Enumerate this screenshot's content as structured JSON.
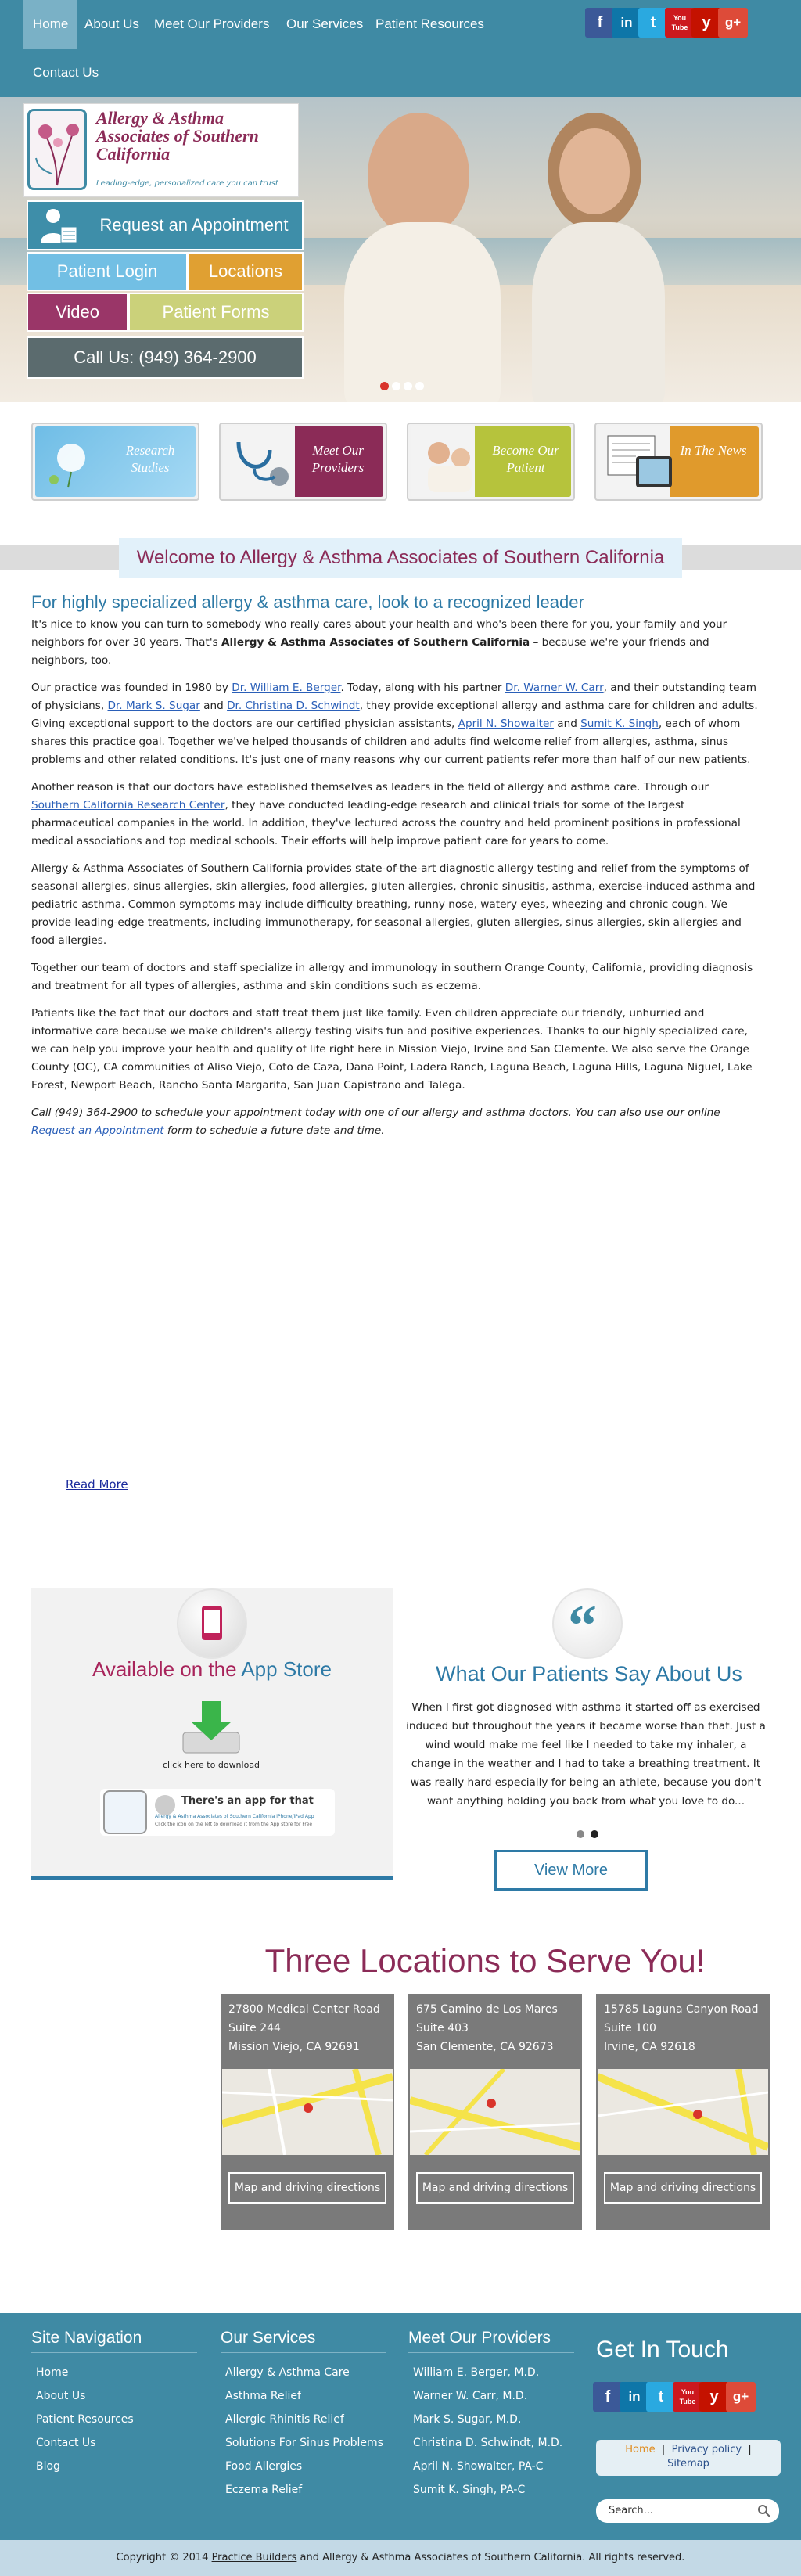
{
  "nav": {
    "items": [
      {
        "label": "Home"
      },
      {
        "label": "About Us"
      },
      {
        "label": "Meet Our Providers"
      },
      {
        "label": "Our Services"
      },
      {
        "label": "Patient Resources"
      },
      {
        "label": "Contact Us"
      }
    ],
    "social": [
      "f",
      "in",
      "t",
      "You Tube",
      "y",
      "g+"
    ]
  },
  "hero": {
    "logo_name": "Allergy & Asthma Associates of Southern California",
    "logo_tag": "Leading-edge, personalized care you can trust",
    "request": "Request an Appointment",
    "patient_login": "Patient Login",
    "locations": "Locations",
    "video": "Video",
    "patient_forms": "Patient Forms",
    "call": "Call Us: (949) 364-2900"
  },
  "tiles": [
    {
      "label": "Research Studies"
    },
    {
      "label": "Meet Our Providers"
    },
    {
      "label": "Become Our Patient"
    },
    {
      "label": "In The News"
    }
  ],
  "welcome": "Welcome to Allergy & Asthma Associates of Southern California",
  "content": {
    "heading": "For highly specialized allergy & asthma care, look to a recognized leader",
    "p1a": "It's nice to know you can turn to somebody who really cares about your health and who's been there for you, your family and your neighbors for over 30 years. That's ",
    "p1b": "Allergy & Asthma Associates of Southern California",
    "p1c": " – because we're your friends and neighbors, too.",
    "p2a": "Our practice was founded in 1980 by ",
    "p2_berger": "Dr. William E. Berger",
    "p2b": ". Today, along with his partner ",
    "p2_carr": "Dr. Warner W. Carr",
    "p2c": ", and their outstanding team of physicians, ",
    "p2_sugar": "Dr. Mark S. Sugar",
    "p2d": " and ",
    "p2_schwindt": "Dr. Christina D. Schwindt",
    "p2e": ", they provide exceptional allergy and asthma care for children and adults. Giving exceptional support to the doctors are our certified physician assistants, ",
    "p2_showalter": "April N. Showalter",
    "p2f": " and ",
    "p2_singh": "Sumit K. Singh",
    "p2g": ", each of whom shares this practice goal. Together we've helped thousands of children and adults find welcome relief from allergies, asthma, sinus problems and other related conditions. It's just one of many reasons why our current patients refer more than half of our new patients.",
    "p3a": "Another reason is that our doctors have established themselves as leaders in the field of allergy and asthma care. Through our ",
    "p3_link": "Southern California Research Center",
    "p3b": ", they have conducted leading-edge research and clinical trials for some of the largest pharmaceutical companies in the world. In addition, they've lectured across the country and held prominent positions in professional medical associations and top medical schools. Their efforts will help improve patient care for years to come.",
    "p4": "Allergy & Asthma Associates of Southern California provides state-of-the-art diagnostic allergy testing and relief from the symptoms of seasonal allergies, sinus allergies, skin allergies, food allergies, gluten allergies, chronic sinusitis, asthma, exercise-induced asthma and pediatric asthma. Common symptoms may include difficulty breathing, runny nose, watery eyes, wheezing and chronic cough. We provide leading-edge treatments, including immunotherapy, for seasonal allergies, gluten allergies, sinus allergies, skin allergies and food allergies.",
    "p5": "Together our team of doctors and staff specialize in allergy and immunology in southern Orange County, California, providing diagnosis and treatment for all types of allergies, asthma and skin conditions such as eczema.",
    "p6": "Patients like the fact that our doctors and staff treat them just like family. Even children appreciate our friendly, unhurried and informative care because we make children's allergy testing visits fun and positive experiences. Thanks to our highly specialized care, we can help you improve your health and quality of life right here in Mission Viejo, Irvine and San Clemente. We also serve the Orange County (OC), CA communities of Aliso Viejo, Coto de Caza, Dana Point, Ladera Ranch, Laguna Beach, Laguna Hills, Laguna Niguel, Lake Forest, Newport Beach, Rancho Santa Margarita, San Juan Capistrano and Talega.",
    "p7a": "Call (949) 364-2900 to schedule your appointment today with one of our allergy and asthma doctors. You can also use our online ",
    "p7_link": "Request an Appointment",
    "p7b": " form to schedule a future date and time.",
    "read_more": "Read More"
  },
  "app": {
    "title_a": "Available on the ",
    "title_b": "App Store",
    "download": "click here to download",
    "banner_title": "There's an app for that",
    "banner_sub": "Allergy & Asthma Associates of Southern California iPhone/iPad App",
    "banner_sub2": "Click the icon on the left to download it from the App store for Free"
  },
  "testimonial": {
    "title": "What Our Patients Say About Us",
    "quote": "When I first got diagnosed with asthma it started off as exercised induced but throughout the years it became worse than that. Just a wind would make me feel like I needed to take my inhaler, a change in the weather and I had to take a breathing treatment. It was really hard especially for being an athlete, because you don't want anything holding you back from what you love to do...",
    "view_more": "View More"
  },
  "locations": {
    "title": "Three Locations to Serve You!",
    "items": [
      {
        "line1": "27800 Medical Center Road",
        "line2": "Suite 244",
        "line3": "Mission Viejo, CA 92691",
        "button": "Map and driving directions"
      },
      {
        "line1": "675 Camino de Los Mares",
        "line2": "Suite 403",
        "line3": "San Clemente, CA 92673",
        "button": "Map and driving directions"
      },
      {
        "line1": "15785 Laguna Canyon Road",
        "line2": "Suite 100",
        "line3": "Irvine, CA 92618",
        "button": "Map and driving directions"
      }
    ]
  },
  "footer": {
    "nav_title": "Site Navigation",
    "nav_links": [
      "Home",
      "About Us",
      "Patient Resources",
      "Contact Us",
      "Blog"
    ],
    "services_title": "Our Services",
    "services_links": [
      "Allergy & Asthma Care",
      "Asthma Relief",
      "Allergic Rhinitis Relief",
      "Solutions For Sinus Problems",
      "Food Allergies",
      "Eczema Relief"
    ],
    "providers_title": "Meet Our Providers",
    "providers_links": [
      "William E. Berger, M.D.",
      "Warner W. Carr, M.D.",
      "Mark S. Sugar, M.D.",
      "Christina D. Schwindt, M.D.",
      "April N. Showalter, PA-C",
      "Sumit K. Singh, PA-C"
    ],
    "git_title": "Get In Touch",
    "home": "Home",
    "privacy": "Privacy policy",
    "sitemap": "Sitemap",
    "search_placeholder": "Search...",
    "copyright_a": "Copyright © 2014 ",
    "copyright_link": "Practice Builders",
    "copyright_b": " and Allergy & Asthma Associates of Southern California. All rights reserved."
  },
  "colors": {
    "nav": "#3f8aa4",
    "accent_plum": "#8b2b57",
    "accent_blue": "#2e7aa6"
  }
}
